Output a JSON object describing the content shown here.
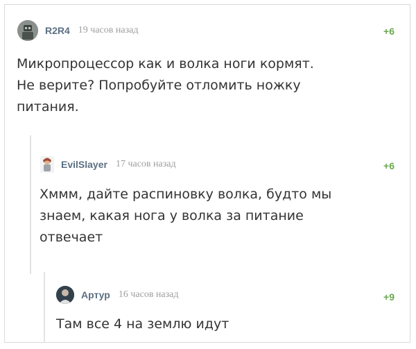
{
  "comments": [
    {
      "author": "R2R4",
      "time": "19 часов назад",
      "rating": "+6",
      "text": "Микропроцессор как и волка ноги кормят.\nНе верите? Попробуйте отломить ножку\nпитания.",
      "avatar_icon": "robot-avatar-icon"
    },
    {
      "author": "EvilSlayer",
      "time": "17 часов назад",
      "rating": "+6",
      "text": "Хммм, дайте распиновку волка, будто мы\nзнаем, какая нога у волка за питание\nотвечает",
      "avatar_icon": "character-avatar-icon"
    },
    {
      "author": "Артур",
      "time": "16 часов назад",
      "rating": "+9",
      "text": "Там все 4 на землю идут",
      "avatar_icon": "person-avatar-icon"
    }
  ],
  "colors": {
    "author": "#5b6f82",
    "time": "#9e9e9e",
    "rating": "#6aa84f",
    "thread_line": "#e3e3e3"
  }
}
